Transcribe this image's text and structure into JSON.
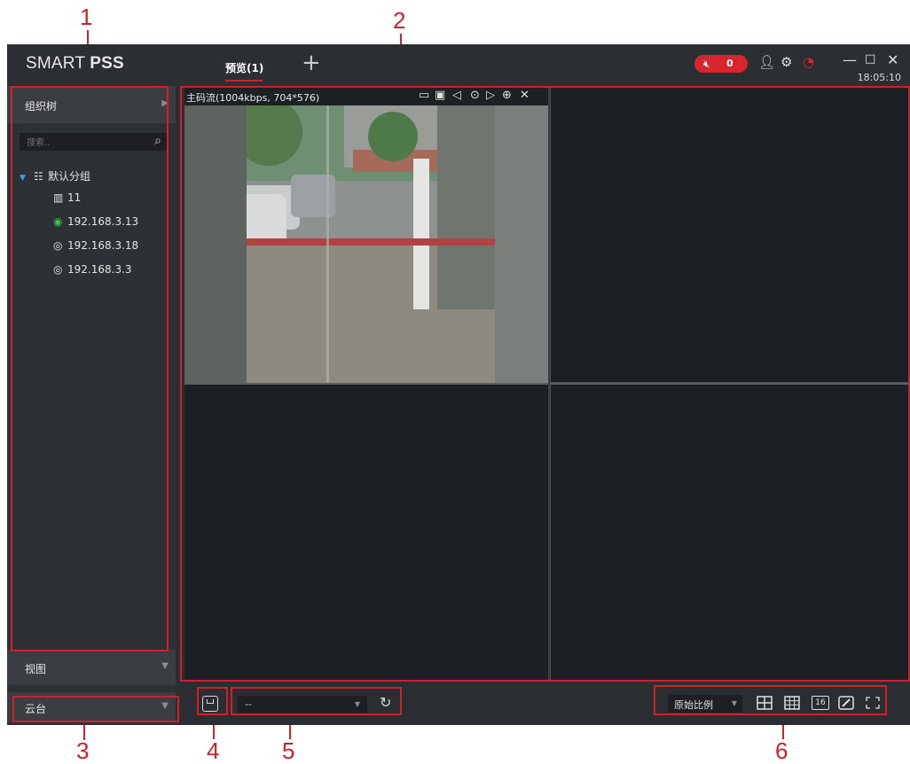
{
  "callouts": [
    "1",
    "2",
    "3",
    "4",
    "5",
    "6"
  ],
  "app": {
    "logo_light": "SMART ",
    "logo_bold": "PSS",
    "tab_label": "预览(1)",
    "add_tab_symbol": "+",
    "alarm_count": "0",
    "clock": "18:05:10",
    "accent_color": "#d7262c"
  },
  "sidebar": {
    "org_title": "组织树",
    "search_placeholder": "搜索..",
    "tree": {
      "group_label": "默认分组",
      "items": [
        {
          "label": "11",
          "icon": "map-icon"
        },
        {
          "label": "192.168.3.13",
          "icon": "camera-online-icon"
        },
        {
          "label": "192.168.3.18",
          "icon": "camera-icon"
        },
        {
          "label": "192.168.3.3",
          "icon": "camera-icon"
        }
      ]
    },
    "view_title": "视图",
    "ptz_title": "云台"
  },
  "video": {
    "stream_info": "主码流(1004kbps, 704*576)"
  },
  "bottom": {
    "view_select_value": "--",
    "ratio_value": "原始比例",
    "layout_16_label": "16"
  }
}
